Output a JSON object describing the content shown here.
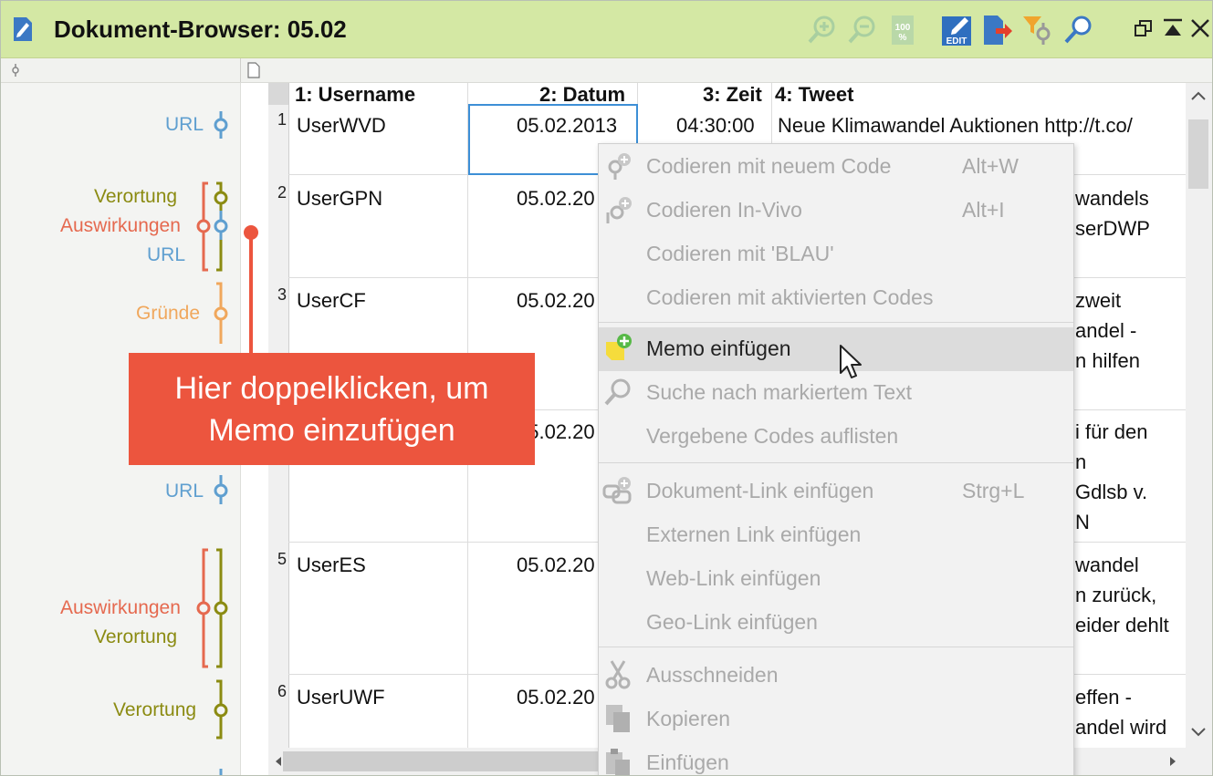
{
  "window": {
    "title": "Dokument-Browser: 05.02"
  },
  "toolbar": {
    "icons": [
      "zoom-in-icon",
      "zoom-out-icon",
      "zoom-100-icon",
      "edit-icon",
      "export-icon",
      "filter-code-icon",
      "search-icon"
    ],
    "edit_badge": "EDIT",
    "zoom_badge": "100 %",
    "window_controls": [
      "restore-icon",
      "pin-top-icon",
      "close-icon"
    ]
  },
  "code_stripes": [
    {
      "label": "URL",
      "color": "#5f9fd0"
    },
    {
      "label": "Verortung",
      "color": "#8b8b12"
    },
    {
      "label": "Auswirkungen",
      "color": "#e5694f"
    },
    {
      "label": "URL",
      "color": "#5f9fd0"
    },
    {
      "label": "Gründe",
      "color": "#f0a75c"
    },
    {
      "label": "URL",
      "color": "#5f9fd0"
    },
    {
      "label": "Auswirkungen",
      "color": "#e5694f"
    },
    {
      "label": "Verortung",
      "color": "#8b8b12"
    },
    {
      "label": "Verortung",
      "color": "#8b8b12"
    }
  ],
  "table": {
    "columns": [
      "1: Username",
      "2: Datum",
      "3: Zeit",
      "4: Tweet"
    ],
    "rows": [
      {
        "num": "1",
        "username": "UserWVD",
        "datum": "05.02.2013",
        "zeit": "04:30:00",
        "tweet": [
          "Neue Klimawandel Auktionen http://t.co/"
        ]
      },
      {
        "num": "2",
        "username": "UserGPN",
        "datum": "05.02.20",
        "zeit": "",
        "tweet": [
          "wandels",
          "serDWP"
        ]
      },
      {
        "num": "3",
        "username": "UserCF",
        "datum": "05.02.20",
        "zeit": "",
        "tweet": [
          "zweit",
          "andel -",
          "n hilfen"
        ]
      },
      {
        "num": "",
        "username": "",
        "datum": "05.02.20",
        "zeit": "",
        "tweet": [
          "i für den",
          "n",
          "Gdlsb v.",
          "N"
        ]
      },
      {
        "num": "5",
        "username": "UserES",
        "datum": "05.02.20",
        "zeit": "",
        "tweet": [
          "wandel",
          "n zurück,",
          "eider dehlt"
        ]
      },
      {
        "num": "6",
        "username": "UserUWF",
        "datum": "05.02.20",
        "zeit": "",
        "tweet": [
          "effen -",
          "andel wird"
        ]
      }
    ]
  },
  "context_menu": {
    "items": [
      {
        "label": "Codieren mit neuem Code",
        "shortcut": "Alt+W",
        "icon": "code-new-icon"
      },
      {
        "label": "Codieren In-Vivo",
        "shortcut": "Alt+I",
        "icon": "code-invivo-icon"
      },
      {
        "label": "Codieren mit 'BLAU'",
        "shortcut": "",
        "icon": ""
      },
      {
        "label": "Codieren mit aktivierten Codes",
        "shortcut": "",
        "icon": ""
      },
      {
        "label": "Memo einfügen",
        "shortcut": "",
        "icon": "memo-add-icon"
      },
      {
        "label": "Suche nach markiertem Text",
        "shortcut": "",
        "icon": "search-icon"
      },
      {
        "label": "Vergebene Codes auflisten",
        "shortcut": "",
        "icon": ""
      },
      {
        "label": "Dokument-Link einfügen",
        "shortcut": "Strg+L",
        "icon": "link-icon"
      },
      {
        "label": "Externen Link einfügen",
        "shortcut": "",
        "icon": ""
      },
      {
        "label": "Web-Link einfügen",
        "shortcut": "",
        "icon": ""
      },
      {
        "label": "Geo-Link einfügen",
        "shortcut": "",
        "icon": ""
      },
      {
        "label": "Ausschneiden",
        "shortcut": "",
        "icon": "scissors-icon"
      },
      {
        "label": "Kopieren",
        "shortcut": "",
        "icon": "copy-icon"
      },
      {
        "label": "Einfügen",
        "shortcut": "",
        "icon": "paste-icon"
      }
    ],
    "highlighted": "Memo einfügen"
  },
  "callout": {
    "line1": "Hier doppelklicken, um",
    "line2": "Memo einzufügen"
  },
  "colors": {
    "titlebar": "#d4e8a4",
    "callout": "#ec553e",
    "selection": "#3d8fd6"
  }
}
